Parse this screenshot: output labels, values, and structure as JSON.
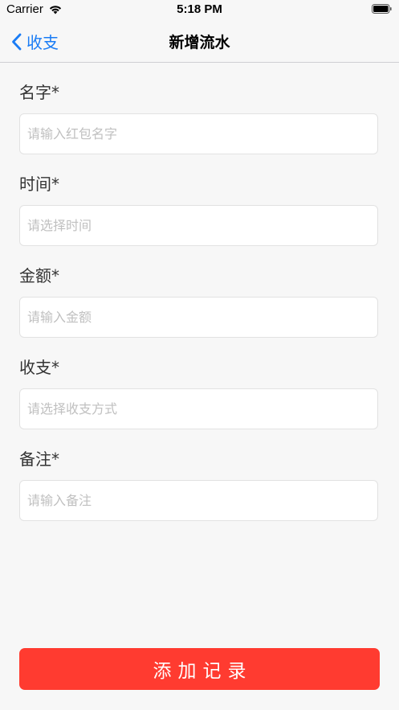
{
  "status_bar": {
    "carrier": "Carrier",
    "time": "5:18 PM"
  },
  "nav": {
    "back_label": "收支",
    "title": "新增流水",
    "accent_color": "#1a7cf5"
  },
  "form": {
    "fields": [
      {
        "label": "名字*",
        "placeholder": "请输入红包名字",
        "value": ""
      },
      {
        "label": "时间*",
        "placeholder": "请选择时间",
        "value": ""
      },
      {
        "label": "金额*",
        "placeholder": "请输入金额",
        "value": ""
      },
      {
        "label": "收支*",
        "placeholder": "请选择收支方式",
        "value": ""
      },
      {
        "label": "备注*",
        "placeholder": "请输入备注",
        "value": ""
      }
    ]
  },
  "submit": {
    "label": "添加记录",
    "color": "#ff3b30"
  },
  "icons": {
    "back": "chevron-left-icon",
    "wifi": "wifi-icon",
    "battery": "battery-icon"
  }
}
